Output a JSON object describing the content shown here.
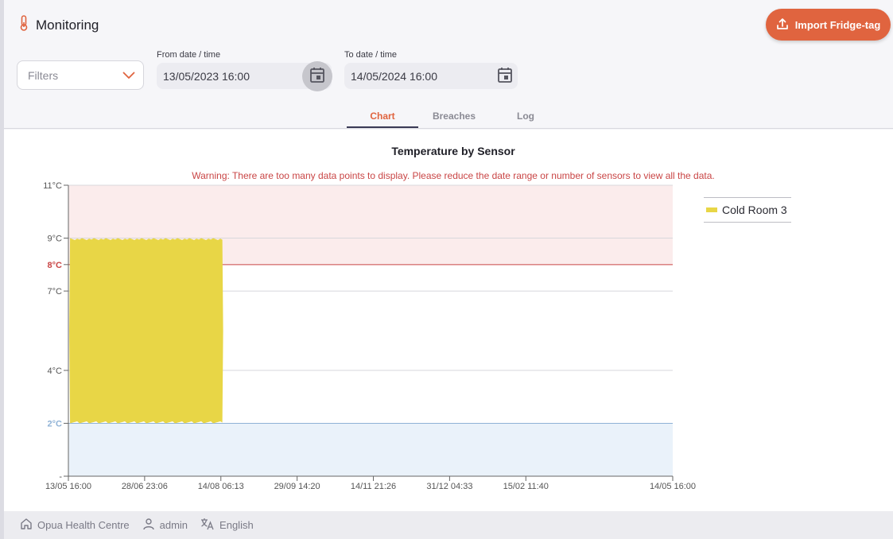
{
  "header": {
    "title": "Monitoring",
    "import_button": "Import Fridge-tag"
  },
  "filters": {
    "placeholder": "Filters"
  },
  "from_date": {
    "label": "From date / time",
    "value": "13/05/2023 16:00"
  },
  "to_date": {
    "label": "To date / time",
    "value": "14/05/2024 16:00"
  },
  "tabs": [
    {
      "label": "Chart",
      "active": true
    },
    {
      "label": "Breaches",
      "active": false
    },
    {
      "label": "Log",
      "active": false
    }
  ],
  "chart": {
    "warning": "Warning: There are too many data points to display. Please reduce the date range or number of sensors to view all the data."
  },
  "chart_data": {
    "type": "area",
    "title": "Temperature by Sensor",
    "xlabel": "",
    "ylabel": "",
    "y_ticks": [
      {
        "value": 11,
        "label": "11°C",
        "highlight": ""
      },
      {
        "value": 9,
        "label": "9°C",
        "highlight": ""
      },
      {
        "value": 8,
        "label": "8°C",
        "highlight": "high"
      },
      {
        "value": 7,
        "label": "7°C",
        "highlight": ""
      },
      {
        "value": 4,
        "label": "4°C",
        "highlight": ""
      },
      {
        "value": 2,
        "label": "2°C",
        "highlight": "low"
      },
      {
        "value": 0,
        "label": "-",
        "highlight": ""
      }
    ],
    "x_ticks": [
      "13/05 16:00",
      "28/06 23:06",
      "14/08 06:13",
      "29/09 14:20",
      "14/11 21:26",
      "31/12 04:33",
      "15/02 11:40",
      "14/05 16:00"
    ],
    "x_tick_days": [
      0,
      46.3,
      92.6,
      138.9,
      185.2,
      231.5,
      277.8,
      367
    ],
    "x_range_days": [
      0,
      367
    ],
    "ylim": [
      0,
      11
    ],
    "thresholds": {
      "high": 8,
      "low": 2
    },
    "colors": {
      "high_zone": "#fbecec",
      "low_zone": "#eaf2fa",
      "high_line": "#c94545",
      "low_line": "#8fb2d6",
      "series": "#e8d646"
    },
    "series": [
      {
        "name": "Cold Room 3",
        "x_start_day": 1,
        "x_end_day": 93.5,
        "y_min": 2,
        "y_max": 9
      }
    ],
    "legend_position": "right"
  },
  "footer": {
    "store": "Opua Health Centre",
    "user": "admin",
    "language": "English"
  },
  "icons": {
    "title": "thermometer-icon",
    "import": "upload-icon",
    "filters": "chevron-down-icon",
    "calendar": "calendar-icon",
    "store": "home-icon",
    "user": "user-icon",
    "language": "translate-icon"
  }
}
